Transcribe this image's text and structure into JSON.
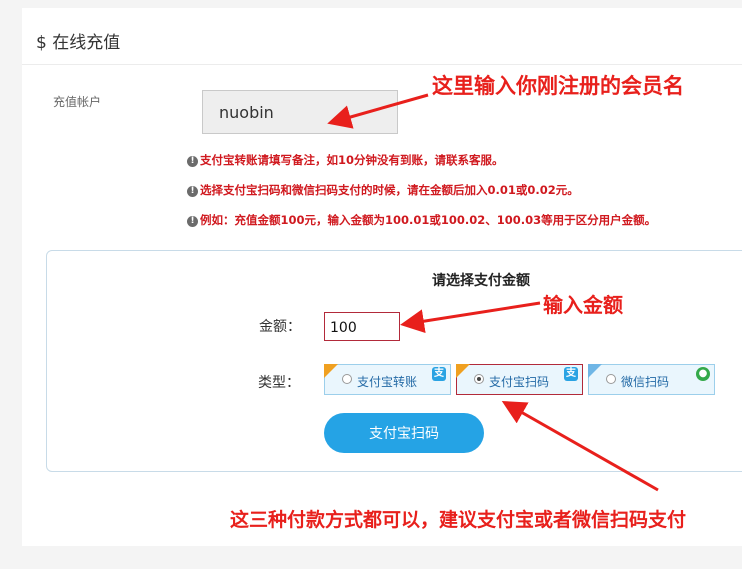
{
  "page": {
    "title": "$ 在线充值"
  },
  "account": {
    "label": "充值帐户",
    "value": "nuobin"
  },
  "notices": [
    "支付宝转账请填写备注，如10分钟没有到账，请联系客服。",
    "选择支付宝扫码和微信扫码支付的时候，请在金额后加入0.01或0.02元。",
    "例如：充值金额100元，输入金额为100.01或100.02、100.03等用于区分用户金额。"
  ],
  "payment": {
    "heading": "请选择支付金额",
    "amount_label": "金额：",
    "amount_value": "100",
    "type_label": "类型：",
    "options": [
      {
        "label": "支付宝转账",
        "icon": "alipay-icon",
        "selected": false
      },
      {
        "label": "支付宝扫码",
        "icon": "alipay-icon",
        "selected": true
      },
      {
        "label": "微信扫码",
        "icon": "wechat-icon",
        "selected": false
      }
    ],
    "submit_label": "支付宝扫码"
  },
  "annotations": {
    "account_hint": "这里输入你刚注册的会员名",
    "amount_hint": "输入金额",
    "method_hint": "这三种付款方式都可以，建议支付宝或者微信扫码支付"
  },
  "colors": {
    "annotation_red": "#e8201c",
    "notice_red": "#d0191f",
    "primary_blue": "#25a3e5",
    "option_border": "#9ccfeb",
    "selected_border": "#b22a3a"
  }
}
